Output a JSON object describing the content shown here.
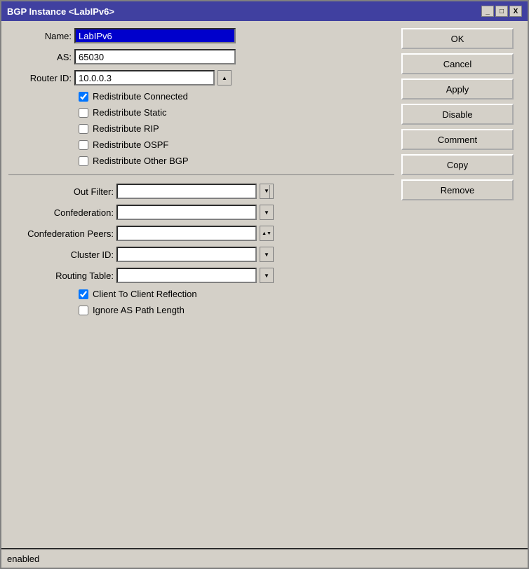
{
  "window": {
    "title": "BGP Instance <LabIPv6>",
    "minimize_label": "_",
    "restore_label": "□",
    "close_label": "X"
  },
  "form": {
    "name_label": "Name:",
    "name_value": "LabIPv6",
    "as_label": "AS:",
    "as_value": "65030",
    "router_id_label": "Router ID:",
    "router_id_value": "10.0.0.3",
    "redistribute_connected_label": "Redistribute Connected",
    "redistribute_connected_checked": true,
    "redistribute_static_label": "Redistribute Static",
    "redistribute_static_checked": false,
    "redistribute_rip_label": "Redistribute RIP",
    "redistribute_rip_checked": false,
    "redistribute_ospf_label": "Redistribute OSPF",
    "redistribute_ospf_checked": false,
    "redistribute_other_bgp_label": "Redistribute Other BGP",
    "redistribute_other_bgp_checked": false,
    "out_filter_label": "Out Filter:",
    "out_filter_value": "",
    "confederation_label": "Confederation:",
    "confederation_value": "",
    "confederation_peers_label": "Confederation Peers:",
    "confederation_peers_value": "",
    "cluster_id_label": "Cluster ID:",
    "cluster_id_value": "",
    "routing_table_label": "Routing Table:",
    "routing_table_value": "",
    "client_to_client_label": "Client To Client Reflection",
    "client_to_client_checked": true,
    "ignore_as_path_label": "Ignore AS Path Length",
    "ignore_as_path_checked": false
  },
  "buttons": {
    "ok": "OK",
    "cancel": "Cancel",
    "apply": "Apply",
    "disable": "Disable",
    "comment": "Comment",
    "copy": "Copy",
    "remove": "Remove"
  },
  "statusbar": {
    "text": "enabled"
  }
}
